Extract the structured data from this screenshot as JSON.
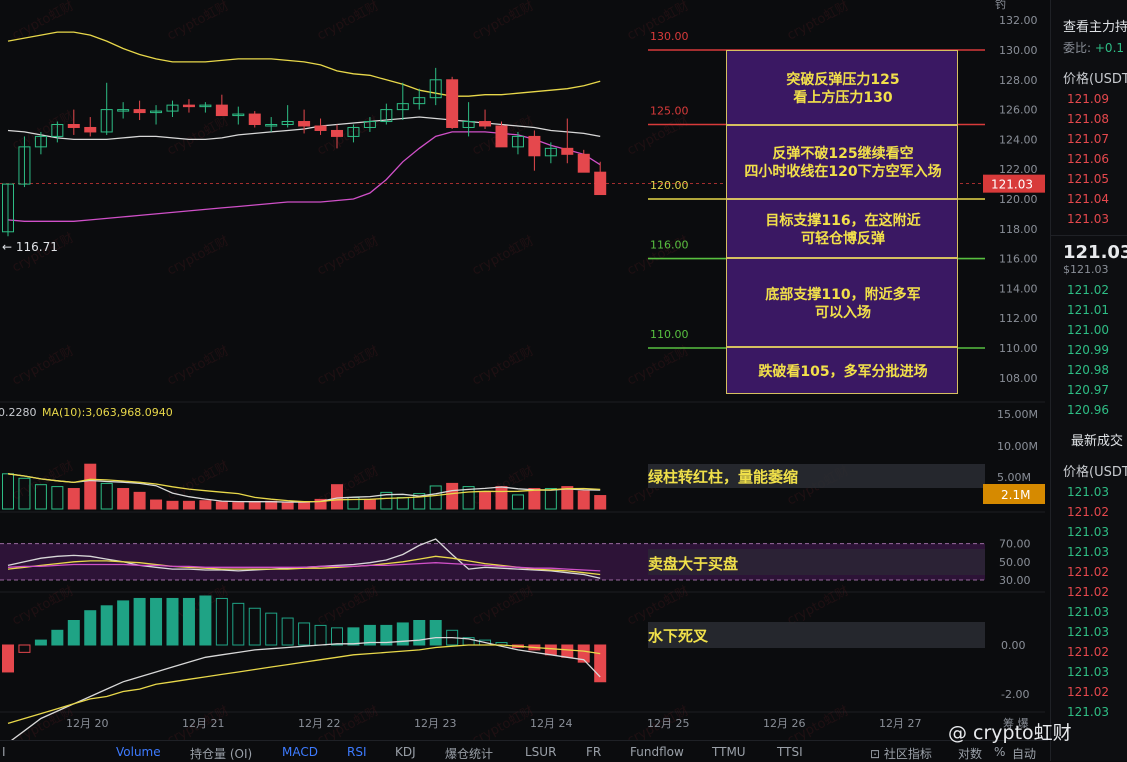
{
  "chart_data": [
    {
      "type": "candlestick",
      "yticks": [
        132,
        130,
        128,
        126,
        124,
        122,
        120,
        118,
        116,
        114,
        112,
        110,
        108
      ],
      "xticks": [
        "12月 20",
        "12月 21",
        "12月 22",
        "12月 23",
        "12月 24",
        "12月 25",
        "12月 26",
        "12月 27"
      ],
      "last_price_label": "121.03",
      "low_marker": "116.71",
      "candles": [
        [
          117.8,
          121.0,
          117.5,
          121.0
        ],
        [
          121.0,
          124.2,
          120.8,
          123.5
        ],
        [
          123.5,
          124.5,
          123.0,
          124.2
        ],
        [
          124.2,
          125.2,
          123.8,
          125.0
        ],
        [
          125.0,
          126.0,
          124.3,
          124.8
        ],
        [
          124.8,
          125.5,
          124.2,
          124.5
        ],
        [
          124.5,
          127.8,
          124.3,
          126.0
        ],
        [
          126.0,
          126.5,
          125.4,
          126.0
        ],
        [
          126.0,
          126.6,
          125.3,
          125.8
        ],
        [
          125.8,
          126.3,
          125.0,
          125.9
        ],
        [
          125.9,
          126.6,
          125.5,
          126.3
        ],
        [
          126.3,
          126.7,
          125.8,
          126.2
        ],
        [
          126.2,
          126.5,
          125.8,
          126.3
        ],
        [
          126.3,
          127.0,
          125.8,
          125.6
        ],
        [
          125.6,
          126.2,
          125.0,
          125.7
        ],
        [
          125.7,
          125.9,
          124.8,
          125.0
        ],
        [
          125.0,
          125.5,
          124.5,
          125.0
        ],
        [
          125.0,
          126.3,
          124.8,
          125.2
        ],
        [
          125.2,
          126.0,
          124.4,
          124.9
        ],
        [
          124.9,
          125.4,
          124.3,
          124.6
        ],
        [
          124.6,
          125.0,
          123.4,
          124.2
        ],
        [
          124.2,
          125.0,
          123.8,
          124.8
        ],
        [
          124.8,
          125.5,
          124.5,
          125.2
        ],
        [
          125.2,
          126.4,
          125.0,
          126.0
        ],
        [
          126.0,
          127.8,
          125.3,
          126.4
        ],
        [
          126.4,
          127.4,
          126.0,
          126.8
        ],
        [
          126.8,
          128.8,
          126.3,
          128.0
        ],
        [
          128.0,
          128.2,
          124.7,
          124.8
        ],
        [
          124.8,
          126.5,
          124.2,
          125.2
        ],
        [
          125.2,
          126.0,
          124.7,
          124.9
        ],
        [
          124.9,
          125.2,
          123.6,
          123.5
        ],
        [
          123.5,
          124.5,
          123.0,
          124.2
        ],
        [
          124.2,
          124.6,
          121.9,
          122.9
        ],
        [
          122.9,
          123.8,
          122.4,
          123.4
        ],
        [
          123.4,
          125.4,
          122.4,
          123.0
        ],
        [
          123.0,
          123.3,
          122.2,
          121.8
        ],
        [
          121.8,
          122.5,
          120.4,
          120.3
        ]
      ],
      "ma_upper": [
        130.6,
        130.8,
        131.0,
        131.2,
        131.2,
        131.0,
        130.6,
        130.1,
        129.7,
        129.4,
        129.2,
        129.2,
        129.2,
        129.3,
        129.4,
        129.4,
        129.4,
        129.3,
        129.2,
        129.0,
        128.6,
        128.4,
        128.3,
        128.0,
        127.7,
        127.3,
        127.1,
        126.9,
        126.9,
        127.0,
        127.0,
        127.1,
        127.2,
        127.3,
        127.4,
        127.6,
        127.9
      ],
      "ma_mid": [
        124.6,
        124.5,
        124.3,
        124.1,
        124.0,
        124.0,
        124.0,
        124.1,
        124.2,
        124.2,
        124.1,
        124.0,
        124.0,
        124.1,
        124.3,
        124.4,
        124.5,
        124.6,
        124.7,
        124.9,
        125.0,
        125.1,
        125.2,
        125.3,
        125.4,
        125.5,
        125.4,
        125.3,
        125.2,
        125.1,
        125.0,
        124.9,
        124.8,
        124.6,
        124.5,
        124.4,
        124.2
      ],
      "ma_lower": [
        118.6,
        118.5,
        118.5,
        118.5,
        118.5,
        118.6,
        118.7,
        118.8,
        118.9,
        119.0,
        119.1,
        119.2,
        119.3,
        119.4,
        119.5,
        119.6,
        119.7,
        119.8,
        119.8,
        119.8,
        119.9,
        120.0,
        120.4,
        121.3,
        122.5,
        123.4,
        124.2,
        124.5,
        124.5,
        124.5,
        124.4,
        124.3,
        124.0,
        123.6,
        123.3,
        123.0,
        122.3
      ],
      "levels": [
        {
          "price": 130.0,
          "label": "130.00",
          "color": "#d83a3a"
        },
        {
          "price": 125.0,
          "label": "125.00",
          "color": "#d83a3a"
        },
        {
          "price": 120.0,
          "label": "120.00",
          "color": "#e8d84a"
        },
        {
          "price": 116.0,
          "label": "116.00",
          "color": "#58c040"
        },
        {
          "price": 110.0,
          "label": "110.00",
          "color": "#58c040"
        }
      ],
      "notes": [
        "突破反弹压力125\n看上方压力130",
        "反弹不破125继续看空\n四小时收线在120下方空军入场",
        "目标支撑116，在这附近\n可轻仓博反弹",
        "底部支撑110，附近多军\n可以入场",
        "跌破看105，多军分批进场"
      ]
    },
    {
      "type": "bar",
      "label_left": "0.2280",
      "ma_label": "MA(10):3,063,968.0940",
      "yticks": [
        "15.00M",
        "10.00M",
        "5.00M"
      ],
      "last_label": "2.1M",
      "note": "绿柱转红柱，量能萎缩",
      "values": [
        5.5,
        4.8,
        3.8,
        3.5,
        3.2,
        7.0,
        4.0,
        3.2,
        2.6,
        1.4,
        1.2,
        1.2,
        1.3,
        1.1,
        1.0,
        1.1,
        1.2,
        1.0,
        1.1,
        1.5,
        3.8,
        1.8,
        1.5,
        2.6,
        1.8,
        2.4,
        3.6,
        4.0,
        3.5,
        2.6,
        3.5,
        2.2,
        3.2,
        3.2,
        3.5,
        2.8,
        2.1
      ],
      "rising": [
        1,
        1,
        1,
        1,
        0,
        0,
        1,
        0,
        0,
        0,
        0,
        0,
        0,
        0,
        0,
        0,
        0,
        0,
        0,
        0,
        0,
        1,
        0,
        1,
        1,
        1,
        1,
        0,
        1,
        0,
        0,
        1,
        0,
        1,
        0,
        0,
        0
      ]
    },
    {
      "type": "line",
      "name": "RSI",
      "yticks": [
        70.0,
        50.0,
        30.0
      ],
      "note": "卖盘大于买盘",
      "series": [
        {
          "values": [
            46,
            50,
            54,
            56,
            57,
            56,
            53,
            50,
            46,
            44,
            42,
            42,
            41,
            41,
            40,
            41,
            42,
            43,
            44,
            45,
            46,
            47,
            49,
            52,
            58,
            68,
            75,
            58,
            42,
            44,
            43,
            42,
            41,
            40,
            38,
            36,
            32
          ]
        },
        {
          "values": [
            42,
            44,
            46,
            48,
            50,
            51,
            51,
            50,
            49,
            47,
            45,
            44,
            43,
            42,
            42,
            42,
            42,
            42,
            43,
            43,
            44,
            45,
            46,
            48,
            50,
            53,
            56,
            54,
            51,
            48,
            46,
            44,
            42,
            41,
            40,
            38,
            36
          ]
        },
        {
          "values": [
            44,
            45,
            45,
            46,
            47,
            47,
            47,
            47,
            46,
            46,
            45,
            45,
            44,
            44,
            44,
            44,
            44,
            44,
            44,
            45,
            45,
            45,
            46,
            46,
            47,
            48,
            49,
            48,
            47,
            46,
            45,
            44,
            43,
            43,
            42,
            41,
            40
          ]
        }
      ]
    },
    {
      "type": "bar",
      "name": "MACD",
      "yticks": [
        0.0,
        -2.0
      ],
      "note": "水下死叉",
      "histogram": [
        -1.1,
        -0.3,
        0.2,
        0.6,
        1.0,
        1.4,
        1.6,
        1.8,
        1.9,
        1.9,
        1.9,
        1.9,
        2.0,
        1.9,
        1.7,
        1.5,
        1.3,
        1.1,
        0.9,
        0.8,
        0.7,
        0.7,
        0.8,
        0.8,
        0.9,
        1.0,
        1.0,
        0.6,
        0.3,
        0.2,
        0.1,
        -0.1,
        -0.2,
        -0.4,
        -0.5,
        -0.7,
        -1.5
      ],
      "series": [
        {
          "values": [
            -4.0,
            -3.5,
            -3.0,
            -2.7,
            -2.4,
            -2.1,
            -1.8,
            -1.5,
            -1.3,
            -1.1,
            -0.9,
            -0.7,
            -0.5,
            -0.4,
            -0.3,
            -0.2,
            -0.15,
            -0.1,
            -0.05,
            0.0,
            0.05,
            0.05,
            0.1,
            0.1,
            0.15,
            0.2,
            0.3,
            0.3,
            0.25,
            0.1,
            -0.05,
            -0.2,
            -0.3,
            -0.4,
            -0.5,
            -0.6,
            -1.3
          ]
        },
        {
          "values": [
            -3.2,
            -3.0,
            -2.8,
            -2.6,
            -2.4,
            -2.2,
            -2.1,
            -1.9,
            -1.8,
            -1.6,
            -1.5,
            -1.4,
            -1.3,
            -1.2,
            -1.1,
            -1.0,
            -0.9,
            -0.8,
            -0.7,
            -0.6,
            -0.5,
            -0.4,
            -0.35,
            -0.3,
            -0.25,
            -0.2,
            -0.1,
            -0.05,
            0.0,
            0.0,
            0.0,
            -0.05,
            -0.1,
            -0.15,
            -0.2,
            -0.25,
            -0.35
          ]
        }
      ]
    }
  ],
  "book": {
    "header": "查看主力持",
    "ratio_label": "委比:",
    "ratio_value": "+0.1",
    "price_header": "价格(USDT",
    "asks": [
      "121.09",
      "121.08",
      "121.07",
      "121.06",
      "121.05",
      "121.04",
      "121.03"
    ],
    "last": "121.03",
    "last_usd": "$121.03",
    "bids": [
      "121.02",
      "121.01",
      "121.00",
      "120.99",
      "120.98",
      "120.97",
      "120.96"
    ],
    "trades_header": "最新成交",
    "trades_price_header": "价格(USDT",
    "trades": [
      {
        "p": "121.03",
        "c": "grn"
      },
      {
        "p": "121.02",
        "c": "red"
      },
      {
        "p": "121.03",
        "c": "grn"
      },
      {
        "p": "121.03",
        "c": "grn"
      },
      {
        "p": "121.02",
        "c": "red"
      },
      {
        "p": "121.02",
        "c": "red"
      },
      {
        "p": "121.03",
        "c": "grn"
      },
      {
        "p": "121.03",
        "c": "grn"
      },
      {
        "p": "121.02",
        "c": "red"
      },
      {
        "p": "121.03",
        "c": "grn"
      },
      {
        "p": "121.02",
        "c": "red"
      },
      {
        "p": "121.03",
        "c": "grn"
      }
    ]
  },
  "toolbar": {
    "items": [
      "Volume",
      "持仓量 (OI)",
      "MACD",
      "RSI",
      "KDJ",
      "爆仓统计",
      "LSUR",
      "FR",
      "Fundflow",
      "TTMU",
      "TTSI"
    ],
    "active": [
      "Volume",
      "MACD",
      "RSI"
    ],
    "community": "社区指标",
    "log": "对数",
    "pct": "%",
    "auto": "自动"
  },
  "watermark_text": "crypto虹财",
  "brand": "@ crypto虹财",
  "misc": {
    "top_left": "钓",
    "bottom_left": "I",
    "right_top_label": "筹 爆"
  }
}
